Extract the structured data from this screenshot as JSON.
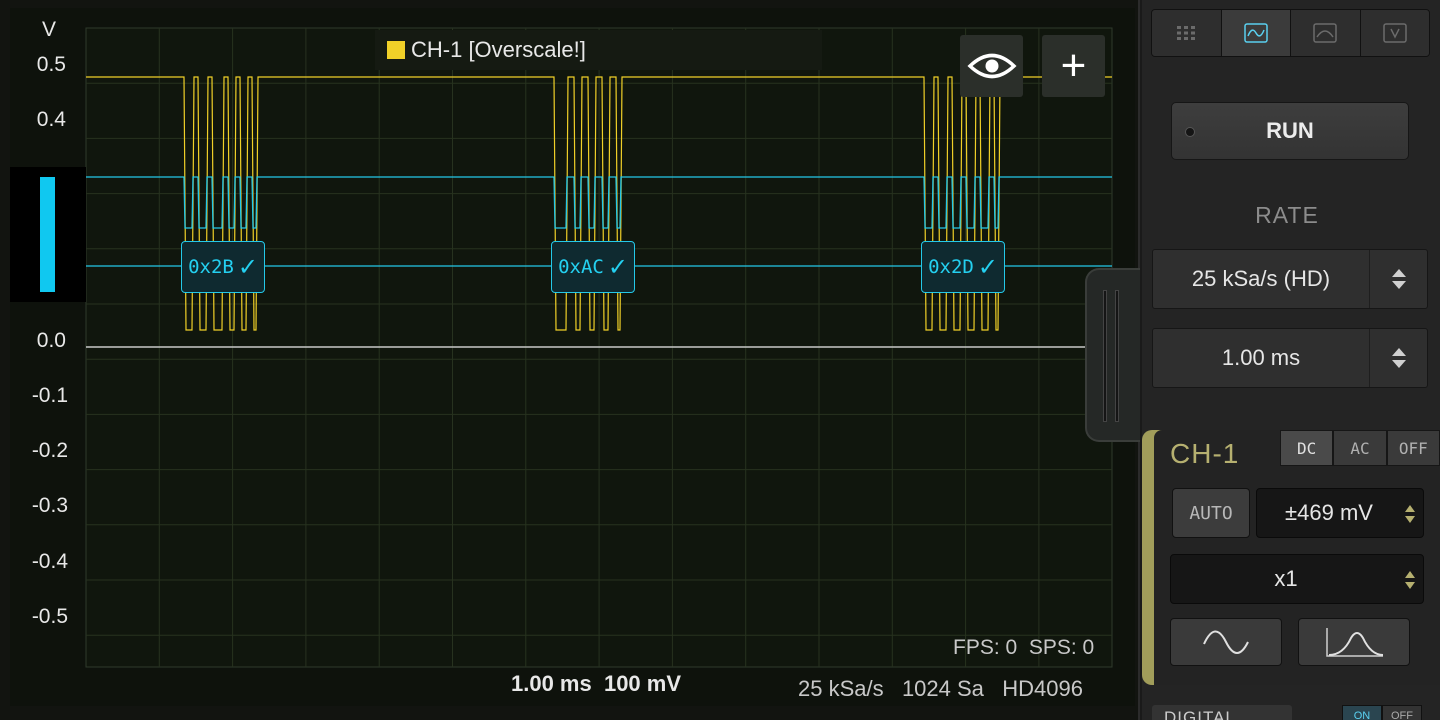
{
  "scope": {
    "axis_unit": "V",
    "y_labels": [
      "0.5",
      "0.4",
      "0.0",
      "-0.1",
      "-0.2",
      "-0.3",
      "-0.4",
      "-0.5"
    ],
    "channel_legend": "CH-1 [Overscale!]",
    "channel_color": "#f0d028",
    "decode_color": "#24d0f0",
    "decodes": [
      {
        "value": "0x2B",
        "check": "✓"
      },
      {
        "value": "0xAC",
        "check": "✓"
      },
      {
        "value": "0x2D",
        "check": "✓"
      }
    ],
    "fps": "FPS: 0  SPS: 0",
    "scale_readout": "1.00 ms  100 mV",
    "info_readout": "25 kSa/s   1024 Sa   HD4096"
  },
  "icons": {
    "eye": "eye-icon",
    "plus": "plus-icon",
    "plus_glyph": "+"
  },
  "panel": {
    "tabs": [
      "grid-icon",
      "scope-icon",
      "spectrum-icon",
      "volt-icon"
    ],
    "run_label": "RUN",
    "rate_label": "RATE",
    "rate_value": "25 kSa/s (HD)",
    "time_value": "1.00 ms",
    "channel": {
      "title": "CH-1",
      "coupling": [
        "DC",
        "AC",
        "OFF"
      ],
      "auto_label": "AUTO",
      "range": "±469 mV",
      "probe": "x1",
      "accent": "#b6b070"
    },
    "digital_label": "DIGITAL",
    "digital_toggle": [
      "ON",
      "OFF"
    ]
  }
}
